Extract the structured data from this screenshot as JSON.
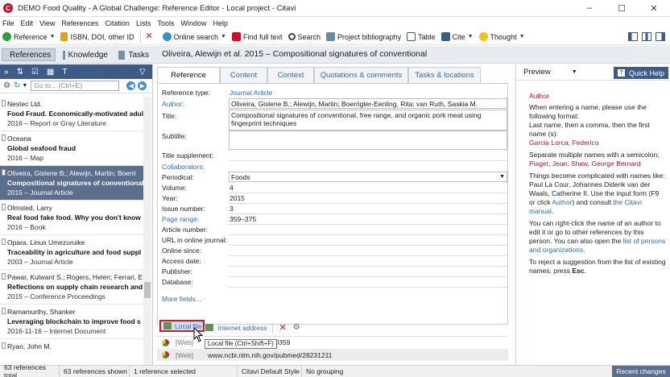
{
  "window": {
    "title": "DEMO Food Quality - A Global Challenge: Reference Editor - Local project - Citavi",
    "app_icon": "C",
    "minimize": "–",
    "maximize": "☐",
    "close": "✕"
  },
  "menu": [
    "File",
    "Edit",
    "View",
    "References",
    "Citation",
    "Lists",
    "Tools",
    "Window",
    "Help"
  ],
  "toolbar": {
    "reference": "Reference",
    "isbn": "ISBN, DOI, other ID",
    "online_search": "Online search",
    "find_full_text": "Find full text",
    "search": "Search",
    "project_bibliography": "Project bibliography",
    "table": "Table",
    "cite": "Cite",
    "thought": "Thought"
  },
  "nav": {
    "references": "References",
    "knowledge": "Knowledge",
    "tasks": "Tasks",
    "current_reference_title": "Oliveira, Alewijn et al. 2015 – Compositional signatures of conventional"
  },
  "left_panel": {
    "search_placeholder": "Go to... (Ctrl+E)",
    "items": [
      {
        "author": "Nestec Ltd.",
        "title": "Food Fraud. Economically-motivated adul",
        "meta": "2016 – Report or Gray Literature",
        "selected": false
      },
      {
        "author": "Oceana",
        "title": "Global seafood fraud",
        "meta": "2016 – Map",
        "selected": false
      },
      {
        "author": "Oliveira, Gislene B.; Alewijn, Martin; Boerri",
        "title": "Compositional signatures of conventional",
        "meta": "2015 – Journal Article",
        "selected": true
      },
      {
        "author": "Olmsted, Larry",
        "title": "Real food fake food. Why you don't know",
        "meta": "2016 – Book",
        "selected": false
      },
      {
        "author": "Opara, Linus Umezuruike",
        "title": "Traceability in agriculture and food suppl",
        "meta": "2003 – Journal Article",
        "selected": false
      },
      {
        "author": "Pawar, Kulwant S.; Rogers, Helen; Ferrari, E",
        "title": "Reflections on supply chain research and",
        "meta": "2015 – Conference Proceedings",
        "selected": false
      },
      {
        "author": "Ramamurthy, Shanker",
        "title": "Leveraging blockchain to improve food s",
        "meta": "2016-11-16 – Internet Document",
        "selected": false
      },
      {
        "author": "Ryan, John M.",
        "title": "",
        "meta": "",
        "selected": false
      }
    ]
  },
  "tabs": [
    "Reference",
    "Content",
    "Context",
    "Quotations & comments",
    "Tasks & locations"
  ],
  "form": {
    "reference_type_label": "Reference type:",
    "reference_type_value": "Journal Article",
    "author_label": "Author:",
    "author_value": "Oliveira, Gislene B.; Alewijn, Martin; Boerrigter-Eenling, Rita; van Ruth, Saskia M.",
    "title_label": "Title:",
    "title_value": "Compositional signatures of conventional, free range, and organic pork meat using fingerprint techniques",
    "subtitle_label": "Subtitle:",
    "title_supplement_label": "Title supplement:",
    "collaborators_label": "Collaborators:",
    "periodical_label": "Periodical:",
    "periodical_value": "Foods",
    "volume_label": "Volume:",
    "volume_value": "4",
    "year_label": "Year:",
    "year_value": "2015",
    "issue_label": "Issue number:",
    "issue_value": "3",
    "page_range_label": "Page range:",
    "page_range_value": "359–375",
    "article_number_label": "Article number:",
    "url_journal_label": "URL in online journal:",
    "online_since_label": "Online since:",
    "access_date_label": "Access date:",
    "publisher_label": "Publisher:",
    "database_label": "Database:",
    "more_fields": "More fields..."
  },
  "attachments": {
    "local_file": "Local file",
    "internet_address": "Internet address",
    "rows": [
      {
        "tag": "[Web]",
        "value": "030359"
      },
      {
        "tag": "[Web]",
        "value": "www.ncbi.nlm.nih.gov/pubmed/28231211"
      }
    ],
    "tooltip": "Local file (Ctrl+Shift+F)"
  },
  "preview": {
    "label": "Preview",
    "quick_help": "Quick Help",
    "heading": "Author",
    "p1": "When entering a name, please use the following format:",
    "p2": "Last name, then a comma, then the first name (s):",
    "ex1": "Garcia Lorca, Federico",
    "p3": "Separate multiple names with a semicolon:",
    "ex2": "Piaget, Jean; Shaw, George Bernard",
    "p4a": "Things become complicated with names like: Paul La Cour, Johannes Diderik van der Waals, Catherine II. Use the input form (F9 or click",
    "p4b": "Author",
    "p4c": ") and consult",
    "p4d": "the Citavi manual",
    "p5a": "You can right-click the name of an author to edit it or go to other references by this person. You can also open the",
    "p5b": "list of persons and organizations",
    "p6": "To reject a suggestion from the list of existing names, press",
    "esc": "Esc"
  },
  "status": {
    "total": "63 references total",
    "shown": "63 references shown",
    "selected": "1 reference selected",
    "style": "Citavi Default Style",
    "grouping": "No grouping",
    "recent_changes": "Recent changes"
  },
  "colors": {
    "accent_blue": "#2a6ebb",
    "selection": "#5b6e8c",
    "highlight_red": "#d0191f",
    "citavi_red": "#c8102e"
  }
}
